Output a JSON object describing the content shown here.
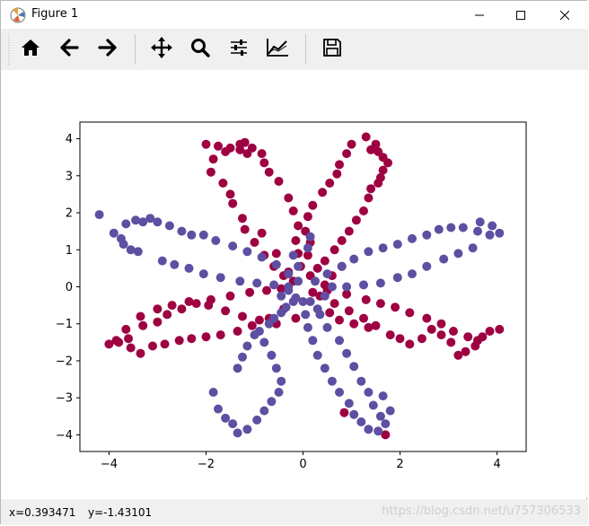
{
  "window": {
    "title": "Figure 1",
    "icon": "matplotlib-logo-icon",
    "controls": [
      "minimize-icon",
      "maximize-icon",
      "close-icon"
    ]
  },
  "toolbar": {
    "buttons": [
      {
        "name": "home",
        "icon": "home-icon"
      },
      {
        "name": "back",
        "icon": "arrow-left-icon"
      },
      {
        "name": "forward",
        "icon": "arrow-right-icon"
      },
      {
        "name": "pan",
        "icon": "move-arrows-icon"
      },
      {
        "name": "zoom",
        "icon": "magnifier-icon"
      },
      {
        "name": "subplots",
        "icon": "sliders-icon"
      },
      {
        "name": "edit-axes",
        "icon": "line-chart-icon"
      },
      {
        "name": "save",
        "icon": "floppy-disk-icon"
      }
    ]
  },
  "status": {
    "x": "x=0.393471",
    "y": "y=-1.43101",
    "watermark": "https://blog.csdn.net/u757306533"
  },
  "chart_data": {
    "type": "scatter",
    "xlim": [
      -4.6,
      4.6
    ],
    "ylim": [
      -4.45,
      4.45
    ],
    "xticks": [
      -4,
      -2,
      0,
      2,
      4
    ],
    "yticks": [
      -4,
      -3,
      -2,
      -1,
      0,
      1,
      2,
      3,
      4
    ],
    "grid": false,
    "colors": {
      "red": "#9e0142",
      "blue": "#5e4fa2"
    },
    "series": [
      {
        "color": "#9e0142",
        "points": [
          [
            -2.0,
            3.85
          ],
          [
            -1.75,
            3.8
          ],
          [
            -1.5,
            3.75
          ],
          [
            -1.3,
            3.85
          ],
          [
            -1.15,
            3.6
          ],
          [
            -1.3,
            3.7
          ],
          [
            -1.6,
            3.65
          ],
          [
            -1.85,
            3.45
          ],
          [
            -1.9,
            3.1
          ],
          [
            -1.65,
            2.8
          ],
          [
            -1.5,
            2.5
          ],
          [
            -1.45,
            2.25
          ],
          [
            -1.25,
            1.85
          ],
          [
            -1.2,
            1.55
          ],
          [
            -1.0,
            1.2
          ],
          [
            -0.8,
            0.85
          ],
          [
            -0.6,
            0.55
          ],
          [
            -0.4,
            0.3
          ],
          [
            -0.2,
            0.15
          ],
          [
            -1.2,
            3.9
          ],
          [
            -1.05,
            3.75
          ],
          [
            -0.85,
            3.6
          ],
          [
            -0.8,
            3.35
          ],
          [
            -0.7,
            3.1
          ],
          [
            -0.5,
            2.85
          ],
          [
            -0.3,
            2.4
          ],
          [
            -0.2,
            2.05
          ],
          [
            -0.1,
            1.65
          ],
          [
            -0.15,
            1.25
          ],
          [
            -0.1,
            0.9
          ],
          [
            -0.05,
            0.55
          ],
          [
            1.3,
            4.05
          ],
          [
            1.5,
            3.85
          ],
          [
            1.4,
            3.7
          ],
          [
            1.55,
            3.65
          ],
          [
            1.65,
            3.5
          ],
          [
            1.75,
            3.35
          ],
          [
            1.65,
            3.15
          ],
          [
            1.6,
            2.95
          ],
          [
            1.55,
            2.8
          ],
          [
            1.4,
            2.65
          ],
          [
            1.35,
            2.4
          ],
          [
            1.25,
            2.05
          ],
          [
            1.1,
            1.8
          ],
          [
            0.95,
            1.5
          ],
          [
            0.8,
            1.25
          ],
          [
            0.65,
            1.0
          ],
          [
            0.45,
            0.7
          ],
          [
            0.3,
            0.5
          ],
          [
            0.15,
            0.3
          ],
          [
            1.0,
            3.85
          ],
          [
            0.9,
            3.6
          ],
          [
            0.75,
            3.3
          ],
          [
            0.7,
            3.05
          ],
          [
            0.55,
            2.8
          ],
          [
            0.4,
            2.55
          ],
          [
            0.2,
            2.2
          ],
          [
            0.1,
            1.9
          ],
          [
            0.05,
            1.5
          ],
          [
            0.15,
            1.2
          ],
          [
            0.1,
            0.85
          ],
          [
            3.85,
            -1.2
          ],
          [
            4.05,
            -1.15
          ],
          [
            3.7,
            -1.35
          ],
          [
            3.6,
            -1.45
          ],
          [
            3.4,
            -1.35
          ],
          [
            3.1,
            -1.2
          ],
          [
            2.85,
            -1.0
          ],
          [
            2.55,
            -0.85
          ],
          [
            2.2,
            -0.7
          ],
          [
            1.9,
            -0.55
          ],
          [
            1.6,
            -0.45
          ],
          [
            1.3,
            -0.35
          ],
          [
            0.9,
            -0.2
          ],
          [
            0.5,
            -0.1
          ],
          [
            3.55,
            -1.6
          ],
          [
            3.35,
            -1.75
          ],
          [
            3.2,
            -1.85
          ],
          [
            3.05,
            -1.5
          ],
          [
            2.85,
            -1.3
          ],
          [
            2.65,
            -1.15
          ],
          [
            2.45,
            -1.4
          ],
          [
            2.2,
            -1.55
          ],
          [
            2.0,
            -1.4
          ],
          [
            1.8,
            -1.3
          ],
          [
            1.5,
            -1.05
          ],
          [
            1.25,
            -0.85
          ],
          [
            0.95,
            -0.65
          ],
          [
            0.65,
            -0.45
          ],
          [
            0.35,
            -0.25
          ],
          [
            -4.0,
            -1.55
          ],
          [
            -3.8,
            -1.5
          ],
          [
            -3.6,
            -1.4
          ],
          [
            -3.55,
            -1.65
          ],
          [
            -3.35,
            -1.8
          ],
          [
            -3.1,
            -1.6
          ],
          [
            -2.85,
            -1.55
          ],
          [
            -2.55,
            -1.45
          ],
          [
            -2.3,
            -1.4
          ],
          [
            -2.0,
            -1.35
          ],
          [
            -1.7,
            -1.3
          ],
          [
            -1.35,
            -1.2
          ],
          [
            -1.05,
            -1.05
          ],
          [
            -0.7,
            -0.85
          ],
          [
            -0.4,
            -0.6
          ],
          [
            -0.15,
            -0.3
          ],
          [
            -3.85,
            -1.45
          ],
          [
            -3.65,
            -1.15
          ],
          [
            -3.3,
            -1.05
          ],
          [
            -3.0,
            -0.95
          ],
          [
            -2.8,
            -0.75
          ],
          [
            -2.5,
            -0.6
          ],
          [
            -2.2,
            -0.45
          ],
          [
            -1.9,
            -0.35
          ],
          [
            -1.5,
            -0.25
          ],
          [
            -1.1,
            -0.15
          ],
          [
            -0.75,
            -0.1
          ],
          [
            -0.45,
            -0.05
          ],
          [
            -3.35,
            -0.8
          ],
          [
            -3.0,
            -0.6
          ],
          [
            -2.7,
            -0.5
          ],
          [
            -2.35,
            -0.4
          ],
          [
            -1.95,
            -0.5
          ],
          [
            -1.6,
            -0.65
          ],
          [
            -1.25,
            -0.8
          ],
          [
            -0.9,
            -0.9
          ],
          [
            -0.55,
            -1.0
          ],
          [
            0.55,
            -0.7
          ],
          [
            0.75,
            -0.9
          ],
          [
            1.05,
            -1.0
          ],
          [
            1.35,
            -1.1
          ],
          [
            0.8,
            0.55
          ],
          [
            0.6,
            0.3
          ],
          [
            0.45,
            0.05
          ],
          [
            -0.3,
            0.4
          ],
          [
            -0.55,
            0.9
          ],
          [
            -0.85,
            1.45
          ],
          [
            1.7,
            -4.0
          ],
          [
            0.85,
            -3.4
          ],
          [
            -0.15,
            -0.85
          ],
          [
            0.2,
            -0.15
          ]
        ]
      },
      {
        "color": "#5e4fa2",
        "points": [
          [
            -4.2,
            1.95
          ],
          [
            -3.9,
            1.45
          ],
          [
            -3.75,
            1.3
          ],
          [
            -3.7,
            1.15
          ],
          [
            -3.55,
            1.0
          ],
          [
            -3.4,
            0.95
          ],
          [
            -3.65,
            1.7
          ],
          [
            -3.45,
            1.8
          ],
          [
            -3.3,
            1.75
          ],
          [
            -3.15,
            1.85
          ],
          [
            -3.0,
            1.75
          ],
          [
            -2.75,
            1.65
          ],
          [
            -2.5,
            1.5
          ],
          [
            -2.3,
            1.4
          ],
          [
            -2.05,
            1.4
          ],
          [
            -1.8,
            1.25
          ],
          [
            -1.45,
            1.1
          ],
          [
            -1.15,
            0.95
          ],
          [
            -0.85,
            0.8
          ],
          [
            -0.55,
            0.6
          ],
          [
            -0.3,
            0.35
          ],
          [
            -0.1,
            0.15
          ],
          [
            -2.9,
            0.7
          ],
          [
            -2.65,
            0.6
          ],
          [
            -2.35,
            0.5
          ],
          [
            -2.05,
            0.35
          ],
          [
            -1.7,
            0.25
          ],
          [
            -1.3,
            0.15
          ],
          [
            -0.95,
            0.1
          ],
          [
            -0.6,
            0.05
          ],
          [
            -0.3,
            0.0
          ],
          [
            3.65,
            1.75
          ],
          [
            3.9,
            1.65
          ],
          [
            4.05,
            1.45
          ],
          [
            3.85,
            1.4
          ],
          [
            3.6,
            1.5
          ],
          [
            3.3,
            1.6
          ],
          [
            3.05,
            1.6
          ],
          [
            2.8,
            1.55
          ],
          [
            2.55,
            1.4
          ],
          [
            2.25,
            1.3
          ],
          [
            1.95,
            1.15
          ],
          [
            1.65,
            1.05
          ],
          [
            1.35,
            0.95
          ],
          [
            1.05,
            0.75
          ],
          [
            0.8,
            0.55
          ],
          [
            0.5,
            0.35
          ],
          [
            0.25,
            0.15
          ],
          [
            3.5,
            1.05
          ],
          [
            3.2,
            0.9
          ],
          [
            2.9,
            0.75
          ],
          [
            2.55,
            0.55
          ],
          [
            2.25,
            0.35
          ],
          [
            1.95,
            0.25
          ],
          [
            1.6,
            0.1
          ],
          [
            1.25,
            0.05
          ],
          [
            0.9,
            0.0
          ],
          [
            0.6,
            0.0
          ],
          [
            -1.85,
            -2.85
          ],
          [
            -1.75,
            -3.3
          ],
          [
            -1.6,
            -3.55
          ],
          [
            -1.45,
            -3.7
          ],
          [
            -1.35,
            -3.95
          ],
          [
            -1.15,
            -3.85
          ],
          [
            -0.95,
            -3.6
          ],
          [
            -0.8,
            -3.35
          ],
          [
            -0.65,
            -3.1
          ],
          [
            -0.5,
            -2.85
          ],
          [
            -0.45,
            -2.55
          ],
          [
            -0.55,
            -2.2
          ],
          [
            -0.65,
            -1.85
          ],
          [
            -0.8,
            -1.5
          ],
          [
            -0.9,
            -1.2
          ],
          [
            -0.6,
            -0.85
          ],
          [
            -0.35,
            -0.55
          ],
          [
            -0.15,
            -0.3
          ],
          [
            -1.35,
            -2.2
          ],
          [
            -1.25,
            -1.9
          ],
          [
            -1.15,
            -1.6
          ],
          [
            -1.0,
            -1.3
          ],
          [
            -0.7,
            -1.0
          ],
          [
            -0.45,
            -0.7
          ],
          [
            -0.2,
            -0.4
          ],
          [
            1.7,
            -3.7
          ],
          [
            1.55,
            -3.9
          ],
          [
            1.35,
            -3.85
          ],
          [
            1.2,
            -3.65
          ],
          [
            1.05,
            -3.45
          ],
          [
            0.95,
            -3.15
          ],
          [
            0.75,
            -2.85
          ],
          [
            0.6,
            -2.55
          ],
          [
            0.45,
            -2.2
          ],
          [
            0.3,
            -1.85
          ],
          [
            0.2,
            -1.45
          ],
          [
            0.1,
            -1.1
          ],
          [
            0.05,
            -0.75
          ],
          [
            0.0,
            -0.4
          ],
          [
            1.65,
            -2.95
          ],
          [
            1.8,
            -3.35
          ],
          [
            1.6,
            -3.5
          ],
          [
            1.45,
            -3.2
          ],
          [
            1.35,
            -2.85
          ],
          [
            1.2,
            -2.55
          ],
          [
            1.05,
            -2.15
          ],
          [
            0.9,
            -1.8
          ],
          [
            0.75,
            -1.45
          ],
          [
            0.5,
            -1.1
          ],
          [
            0.35,
            -0.75
          ],
          [
            0.15,
            -0.4
          ],
          [
            -0.1,
            0.55
          ],
          [
            -0.2,
            0.85
          ],
          [
            0.1,
            1.05
          ],
          [
            0.15,
            1.35
          ],
          [
            -0.45,
            -0.25
          ],
          [
            -0.3,
            -0.1
          ],
          [
            0.3,
            -0.6
          ],
          [
            0.45,
            -0.25
          ]
        ]
      }
    ]
  }
}
